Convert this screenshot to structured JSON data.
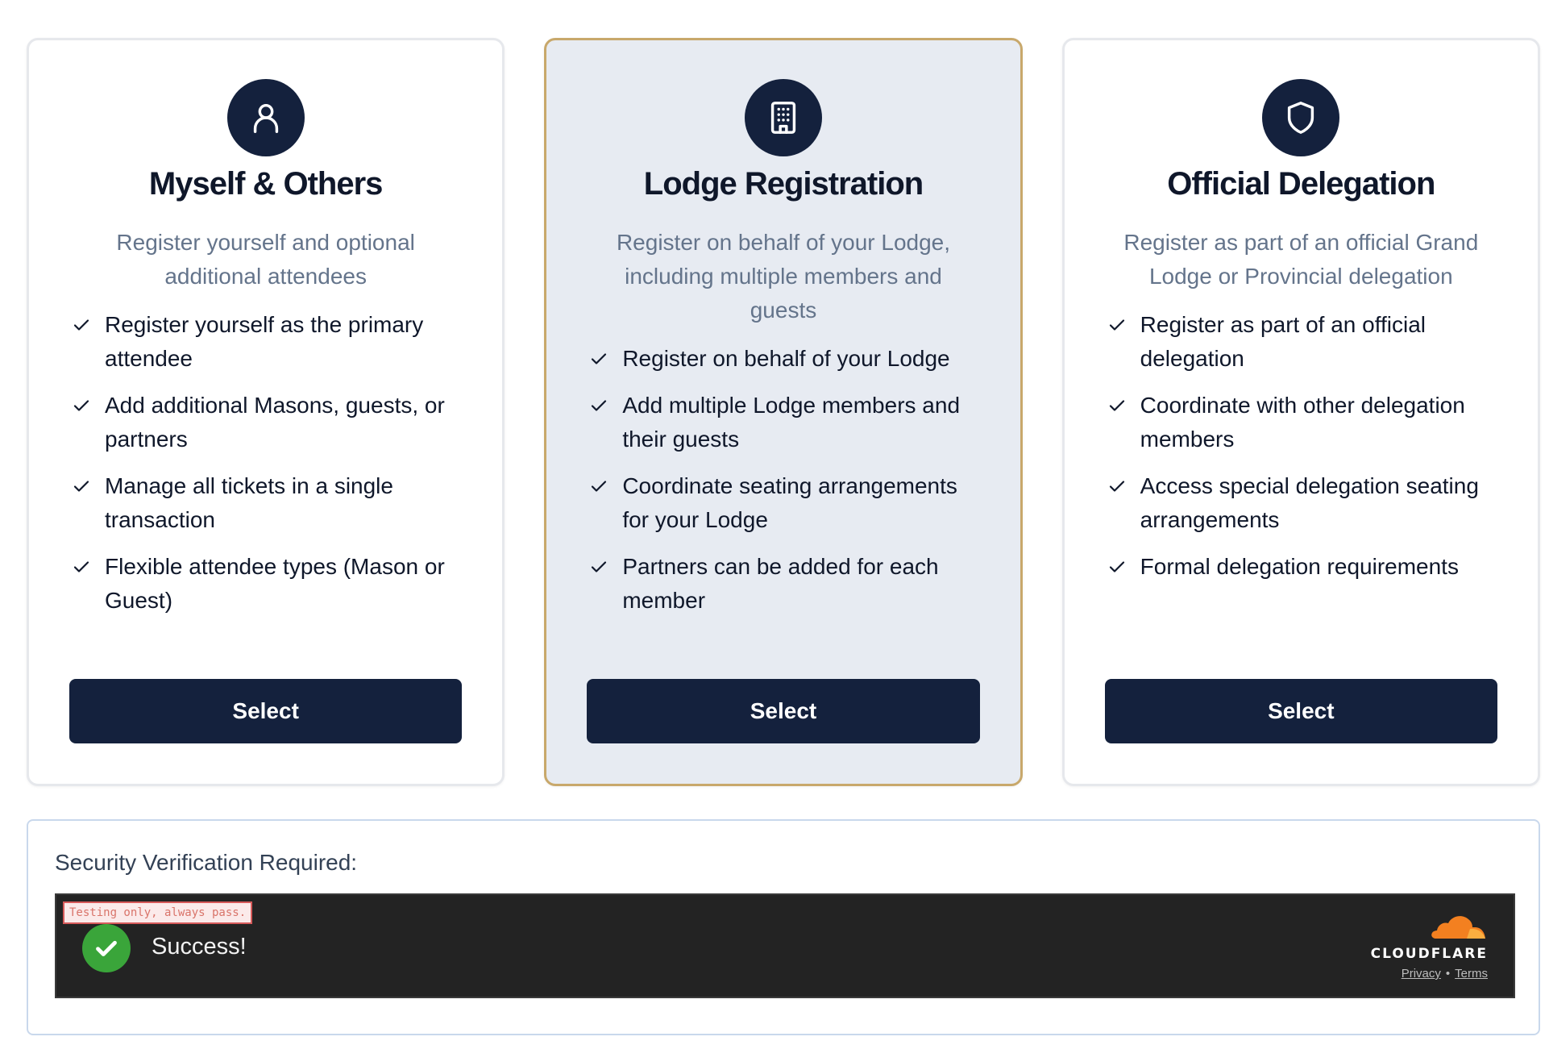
{
  "cards": [
    {
      "icon": "user-icon",
      "title": "Myself & Others",
      "description": "Register yourself and optional additional attendees",
      "features": [
        "Register yourself as the primary attendee",
        "Add additional Masons, guests, or partners",
        "Manage all tickets in a single transaction",
        "Flexible attendee types (Mason or Guest)"
      ],
      "button_label": "Select",
      "selected": false
    },
    {
      "icon": "building-icon",
      "title": "Lodge Registration",
      "description": "Register on behalf of your Lodge, including multiple members and guests",
      "features": [
        "Register on behalf of your Lodge",
        "Add multiple Lodge members and their guests",
        "Coordinate seating arrangements for your Lodge",
        "Partners can be added for each member"
      ],
      "button_label": "Select",
      "selected": true
    },
    {
      "icon": "shield-icon",
      "title": "Official Delegation",
      "description": "Register as part of an official Grand Lodge or Provincial delegation",
      "features": [
        "Register as part of an official delegation",
        "Coordinate with other delegation members",
        "Access special delegation seating arrangements",
        "Formal delegation requirements"
      ],
      "button_label": "Select",
      "selected": false
    }
  ],
  "security": {
    "label": "Security Verification Required:",
    "test_notice": "Testing only, always pass.",
    "status_text": "Success!",
    "provider": "CLOUDFLARE",
    "privacy_link": "Privacy",
    "separator": "•",
    "terms_link": "Terms"
  },
  "colors": {
    "primary": "#14213d",
    "selected_border": "#c8a86b",
    "selected_bg": "#e7ebf2",
    "success": "#3aa53a",
    "cloudflare_orange": "#f38020"
  }
}
